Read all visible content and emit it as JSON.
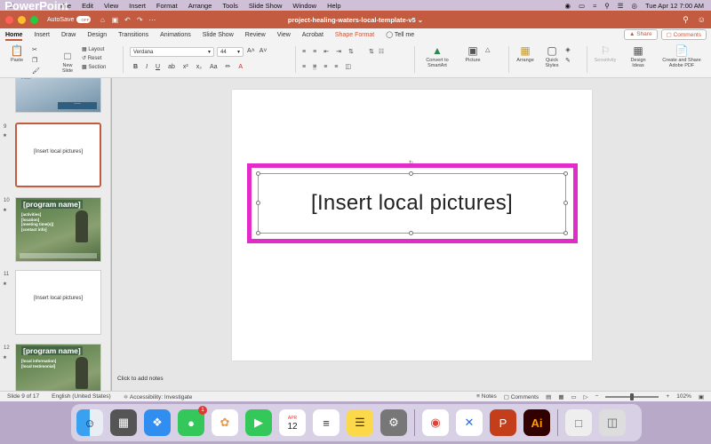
{
  "menubar": {
    "app": "PowerPoint",
    "items": [
      "File",
      "Edit",
      "View",
      "Insert",
      "Format",
      "Arrange",
      "Tools",
      "Slide Show",
      "Window",
      "Help"
    ],
    "clock": "Tue Apr 12  7:00 AM"
  },
  "titlebar": {
    "autosave_label": "AutoSave",
    "autosave_state": "OFF",
    "document_title": "project-healing-waters-local-template-v5"
  },
  "tabs": [
    "Home",
    "Insert",
    "Draw",
    "Design",
    "Transitions",
    "Animations",
    "Slide Show",
    "Review",
    "View",
    "Acrobat",
    "Shape Format",
    "Tell me"
  ],
  "share": {
    "share_label": "Share",
    "comments_label": "Comments"
  },
  "ribbon": {
    "paste": "Paste",
    "new_slide": "New Slide",
    "layout": "Layout",
    "reset": "Reset",
    "section": "Section",
    "font_name": "Verdana",
    "font_size": "44",
    "convert_smartart": "Convert to SmartArt",
    "picture": "Picture",
    "arrange": "Arrange",
    "quick_styles": "Quick Styles",
    "sensitivity": "Sensitivity",
    "design_ideas": "Design Ideas",
    "create_share_pdf": "Create and Share Adobe PDF"
  },
  "slides_panel": {
    "slide9_num": "9",
    "slide9_text": "[Insert local pictures]",
    "slide10_num": "10",
    "slide10_title": "[program name]",
    "slide10_lines": [
      "[activities]",
      "[location]",
      "[meeting time(s)]",
      "[contact info]"
    ],
    "slide11_num": "11",
    "slide11_text": "[Insert local pictures]",
    "slide12_num": "12",
    "slide12_title": "[program name]",
    "slide12_lines": [
      "[local information]",
      "[local testimonial]"
    ]
  },
  "canvas": {
    "slide_text": "[Insert local pictures]",
    "notes_placeholder": "Click to add notes",
    "selection_color": "#e32bc9"
  },
  "status": {
    "slide_count": "Slide 9 of 17",
    "language": "English (United States)",
    "accessibility": "Accessibility: Investigate",
    "notes": "Notes",
    "comments": "Comments",
    "zoom": "102%"
  },
  "dock": {
    "messages_badge": "1",
    "calendar_month": "APR",
    "calendar_day": "12"
  },
  "colors": {
    "accent": "#c25b3f"
  }
}
